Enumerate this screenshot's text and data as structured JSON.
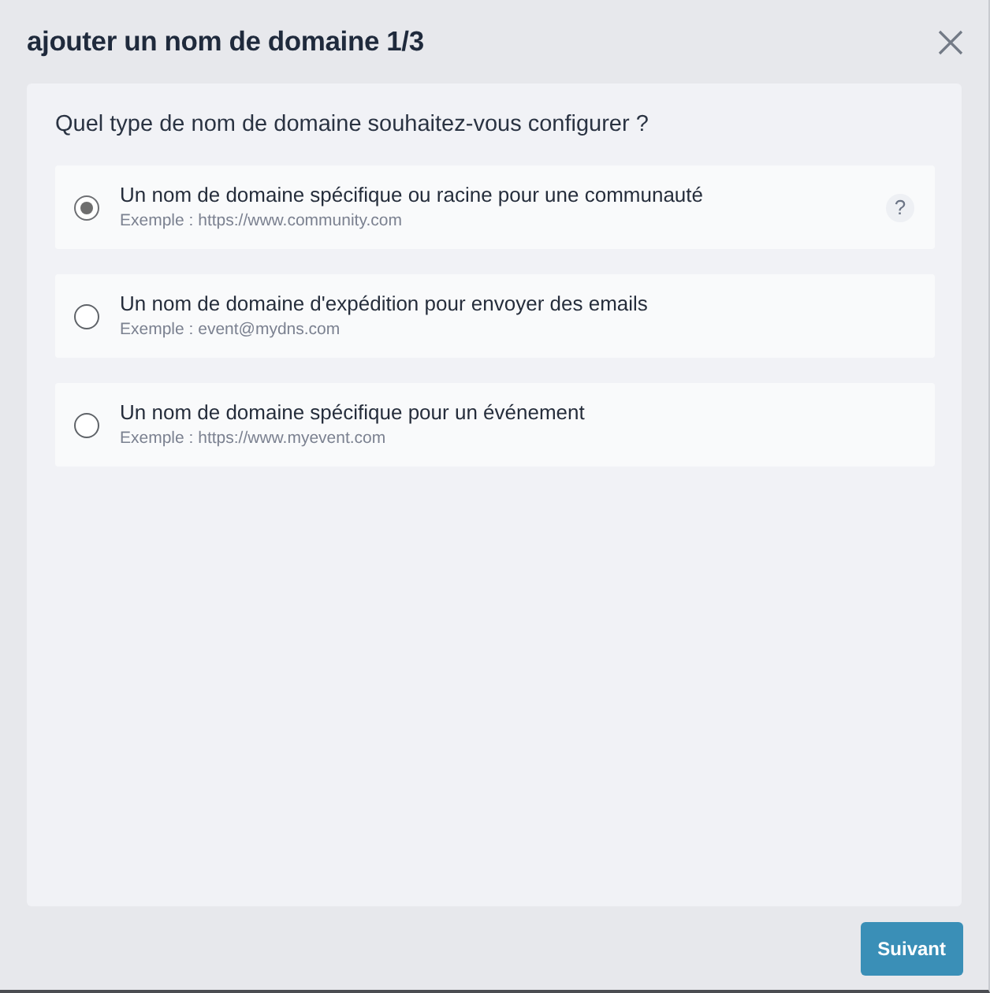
{
  "dialog": {
    "title": "ajouter un nom de domaine 1/3"
  },
  "question": "Quel type de nom de domaine souhaitez-vous configurer ?",
  "options": [
    {
      "label": "Un nom de domaine spécifique ou racine pour une communauté",
      "example": "Exemple : https://www.community.com",
      "selected": true,
      "help": "?"
    },
    {
      "label": "Un nom de domaine d'expédition pour envoyer des emails",
      "example": "Exemple : event@mydns.com",
      "selected": false
    },
    {
      "label": "Un nom de domaine spécifique pour un événement",
      "example": "Exemple : https://www.myevent.com",
      "selected": false
    }
  ],
  "buttons": [
    {
      "label": "Suivant"
    }
  ]
}
